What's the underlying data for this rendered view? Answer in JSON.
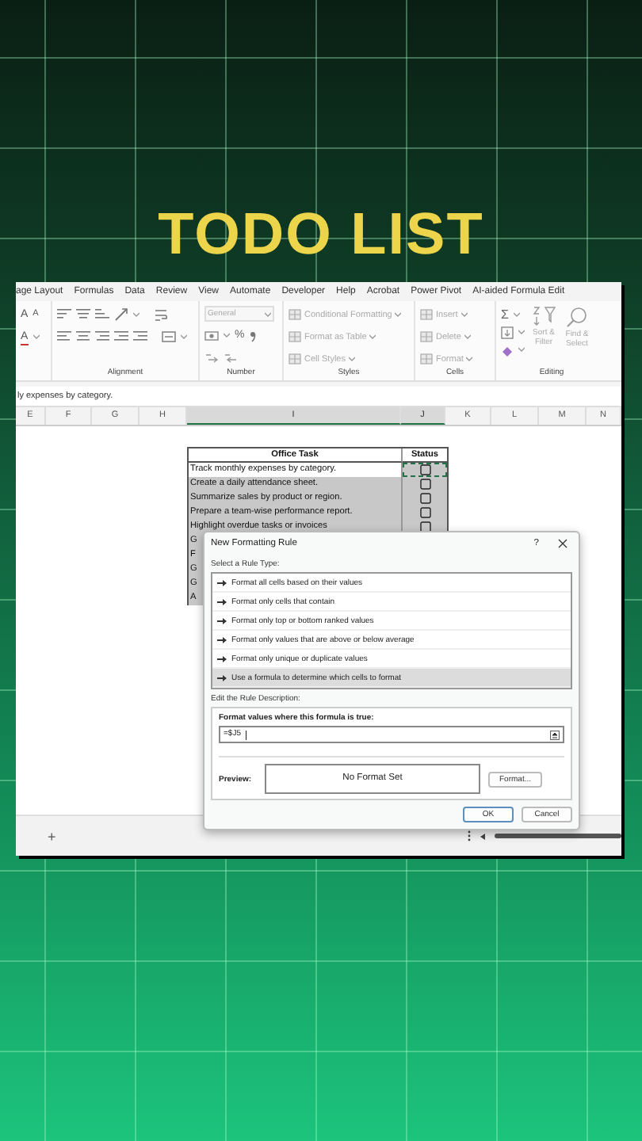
{
  "headline": "TODO LIST",
  "ribbon_tabs": [
    "age Layout",
    "Formulas",
    "Data",
    "Review",
    "View",
    "Automate",
    "Developer",
    "Help",
    "Acrobat",
    "Power Pivot",
    "AI-aided Formula Edit"
  ],
  "ribbon": {
    "groups": [
      {
        "font_buttons": [
          "A",
          "A",
          "A"
        ]
      },
      {
        "label": "Alignment"
      },
      {
        "label": "Number",
        "format": "General",
        "percent": "%"
      },
      {
        "label": "Styles",
        "items": [
          "Conditional Formatting",
          "Format as Table",
          "Cell Styles"
        ]
      },
      {
        "label": "Cells",
        "items": [
          "Insert",
          "Delete",
          "Format"
        ]
      },
      {
        "label": "Editing",
        "sum": "Σ",
        "items": [
          "Sort & Filter",
          "Find & Select"
        ]
      }
    ]
  },
  "formula_bar": "ly expenses by category.",
  "column_heads": [
    {
      "label": "E",
      "selected": false
    },
    {
      "label": "F",
      "selected": false
    },
    {
      "label": "G",
      "selected": false
    },
    {
      "label": "H",
      "selected": false
    },
    {
      "label": "I",
      "selected": true
    },
    {
      "label": "J",
      "selected": true
    },
    {
      "label": "K",
      "selected": false
    },
    {
      "label": "L",
      "selected": false
    },
    {
      "label": "M",
      "selected": false
    },
    {
      "label": "N",
      "selected": false
    }
  ],
  "table": {
    "columns": [
      "Office Task",
      "Status"
    ],
    "rows": [
      {
        "task": "Track monthly expenses by category.",
        "checked": false,
        "active": true
      },
      {
        "task": "Create a daily attendance sheet.",
        "checked": false,
        "active": false
      },
      {
        "task": "Summarize sales by product or region.",
        "checked": false,
        "active": false
      },
      {
        "task": "Prepare a team-wise performance report.",
        "checked": false,
        "active": false
      },
      {
        "task": "Highlight overdue tasks or invoices",
        "checked": false,
        "active": false
      },
      {
        "task": "G",
        "active": false
      },
      {
        "task": "F",
        "active": false
      },
      {
        "task": "G",
        "active": false
      },
      {
        "task": "G",
        "active": false
      },
      {
        "task": "A",
        "active": false
      }
    ]
  },
  "dialog": {
    "title": "New Formatting Rule",
    "help": "?",
    "select_label": "Select a Rule Type:",
    "rule_types": [
      {
        "label": "Format all cells based on their values",
        "selected": false
      },
      {
        "label": "Format only cells that contain",
        "selected": false
      },
      {
        "label": "Format only top or bottom ranked values",
        "selected": false
      },
      {
        "label": "Format only values that are above or below average",
        "selected": false
      },
      {
        "label": "Format only unique or duplicate values",
        "selected": false
      },
      {
        "label": "Use a formula to determine which cells to format",
        "selected": true
      }
    ],
    "edit_label": "Edit the Rule Description:",
    "formula_label": "Format values where this formula is true:",
    "formula_value": "=$J5",
    "preview_label": "Preview:",
    "preview_text": "No Format Set",
    "format_button": "Format...",
    "buttons": [
      "OK",
      "Cancel"
    ]
  },
  "sheet_bar": {
    "add": "+"
  }
}
